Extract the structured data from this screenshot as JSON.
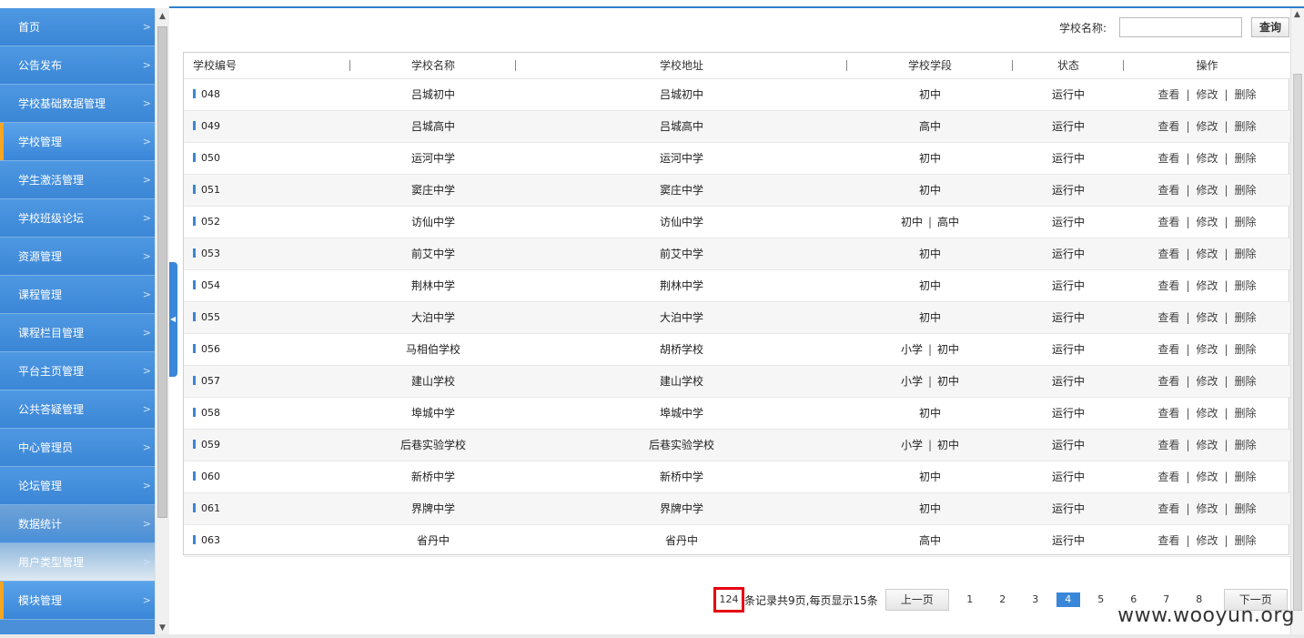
{
  "sidebar": {
    "items": [
      {
        "label": "首页"
      },
      {
        "label": "公告发布"
      },
      {
        "label": "学校基础数据管理"
      },
      {
        "label": "学校管理"
      },
      {
        "label": "学生激活管理"
      },
      {
        "label": "学校班级论坛"
      },
      {
        "label": "资源管理"
      },
      {
        "label": "课程管理"
      },
      {
        "label": "课程栏目管理"
      },
      {
        "label": "平台主页管理"
      },
      {
        "label": "公共答疑管理"
      },
      {
        "label": "中心管理员"
      },
      {
        "label": "论坛管理"
      },
      {
        "label": "数据统计"
      },
      {
        "label": "用户类型管理"
      },
      {
        "label": "模块管理"
      }
    ],
    "chevron": ">"
  },
  "search": {
    "label": "学校名称:",
    "value": "",
    "button": "查询"
  },
  "table": {
    "headers": [
      "学校编号",
      "学校名称",
      "学校地址",
      "学校学段",
      "状态",
      "操作"
    ],
    "ops": {
      "view": "查看",
      "edit": "修改",
      "delete": "删除",
      "sep": "|"
    },
    "rows": [
      {
        "code": "048",
        "name": "吕城初中",
        "addr": "吕城初中",
        "stage": [
          "初中"
        ],
        "status": "运行中"
      },
      {
        "code": "049",
        "name": "吕城高中",
        "addr": "吕城高中",
        "stage": [
          "高中"
        ],
        "status": "运行中"
      },
      {
        "code": "050",
        "name": "运河中学",
        "addr": "运河中学",
        "stage": [
          "初中"
        ],
        "status": "运行中"
      },
      {
        "code": "051",
        "name": "窦庄中学",
        "addr": "窦庄中学",
        "stage": [
          "初中"
        ],
        "status": "运行中"
      },
      {
        "code": "052",
        "name": "访仙中学",
        "addr": "访仙中学",
        "stage": [
          "初中",
          "高中"
        ],
        "status": "运行中"
      },
      {
        "code": "053",
        "name": "前艾中学",
        "addr": "前艾中学",
        "stage": [
          "初中"
        ],
        "status": "运行中"
      },
      {
        "code": "054",
        "name": "荆林中学",
        "addr": "荆林中学",
        "stage": [
          "初中"
        ],
        "status": "运行中"
      },
      {
        "code": "055",
        "name": "大泊中学",
        "addr": "大泊中学",
        "stage": [
          "初中"
        ],
        "status": "运行中"
      },
      {
        "code": "056",
        "name": "马相伯学校",
        "addr": "胡桥学校",
        "stage": [
          "小学",
          "初中"
        ],
        "status": "运行中"
      },
      {
        "code": "057",
        "name": "建山学校",
        "addr": "建山学校",
        "stage": [
          "小学",
          "初中"
        ],
        "status": "运行中"
      },
      {
        "code": "058",
        "name": "埠城中学",
        "addr": "埠城中学",
        "stage": [
          "初中"
        ],
        "status": "运行中"
      },
      {
        "code": "059",
        "name": "后巷实验学校",
        "addr": "后巷实验学校",
        "stage": [
          "小学",
          "初中"
        ],
        "status": "运行中"
      },
      {
        "code": "060",
        "name": "新桥中学",
        "addr": "新桥中学",
        "stage": [
          "初中"
        ],
        "status": "运行中"
      },
      {
        "code": "061",
        "name": "界牌中学",
        "addr": "界牌中学",
        "stage": [
          "初中"
        ],
        "status": "运行中"
      },
      {
        "code": "063",
        "name": "省丹中",
        "addr": "省丹中",
        "stage": [
          "高中"
        ],
        "status": "运行中"
      }
    ]
  },
  "pager": {
    "total": "124",
    "summary": "条记录共9页,每页显示15条",
    "prev": "上一页",
    "next": "下一页",
    "pages": [
      "1",
      "2",
      "3",
      "4",
      "5",
      "6",
      "7",
      "8"
    ],
    "current": "4"
  },
  "watermark": "www.wooyun.org",
  "colors": {
    "accent": "#3a86d8",
    "highlight": "#e60012",
    "selected_marker": "#f5a623"
  }
}
